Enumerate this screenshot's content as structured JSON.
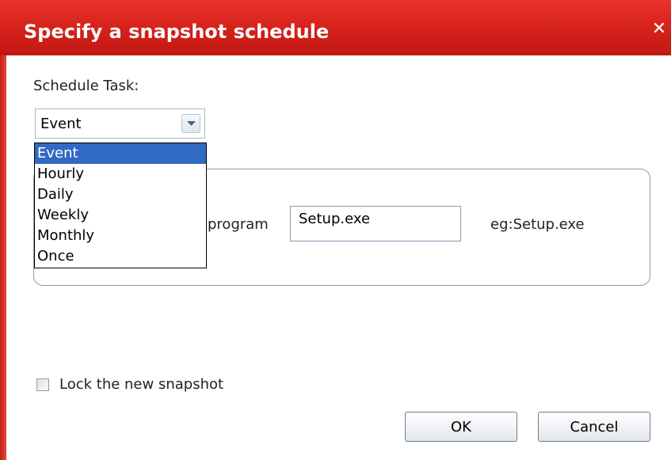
{
  "dialog": {
    "title": "Specify a snapshot schedule",
    "close_icon": "close-icon",
    "title_color": "#d4201a"
  },
  "schedule": {
    "label": "Schedule Task:",
    "selected": "Event",
    "options": [
      "Event",
      "Hourly",
      "Daily",
      "Weekly",
      "Monthly",
      "Once"
    ]
  },
  "program": {
    "label": "program",
    "value": "Setup.exe",
    "example": "eg:Setup.exe"
  },
  "lock": {
    "label": "Lock the new snapshot",
    "checked": false
  },
  "buttons": {
    "ok": "OK",
    "cancel": "Cancel"
  }
}
